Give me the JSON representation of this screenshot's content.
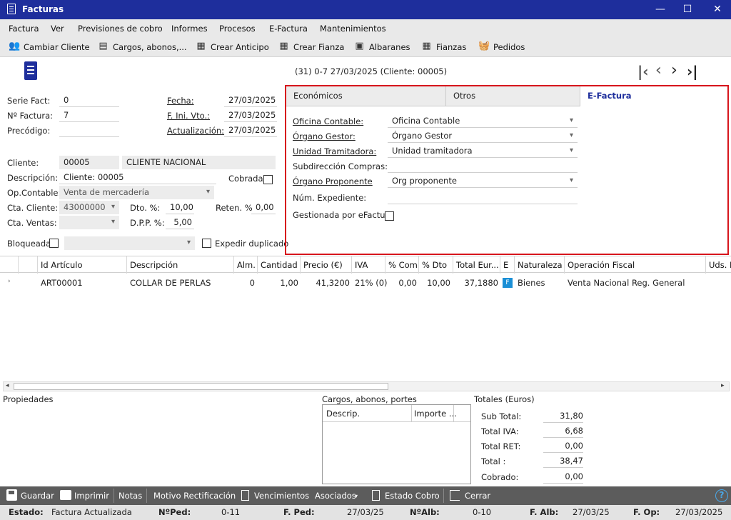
{
  "window": {
    "title": "Facturas",
    "minimize": "—",
    "maximize": "☐",
    "close": "✕"
  },
  "menu": [
    "Factura",
    "Ver",
    "Previsiones de cobro",
    "Informes",
    "Procesos",
    "E-Factura",
    "Mantenimientos"
  ],
  "toolbar": {
    "cambiar": "Cambiar Cliente",
    "cargos": "Cargos, abonos,...",
    "anticipo": "Crear Anticipo",
    "fianza": "Crear Fianza",
    "albaranes": "Albaranes",
    "fianzas": "Fianzas",
    "pedidos": "Pedidos"
  },
  "header_info": "(31) 0-7  27/03/2025  (Cliente: 00005)",
  "form": {
    "serie_label": "Serie Fact:",
    "serie": "0",
    "nfactura_label": "Nº Factura:",
    "nfactura": "7",
    "precodigo_label": "Precódigo:",
    "precodigo": "",
    "fecha_label": "Fecha:",
    "fecha": "27/03/2025",
    "fini_label": "F. Ini. Vto.:",
    "fini": "27/03/2025",
    "actual_label": "Actualización:",
    "actual": "27/03/2025",
    "cliente_label": "Cliente:",
    "cliente_code": "00005",
    "cliente_name": "CLIENTE NACIONAL",
    "desc_label": "Descripción:",
    "desc": "Cliente: 00005",
    "cobrada_label": "Cobrada:",
    "opcontable_label": "Op.Contable:",
    "opcontable": "Venta de mercadería",
    "ctacliente_label": "Cta. Cliente:",
    "ctacliente": "43000000",
    "dto_label": "Dto. %:",
    "dto": "10,00",
    "reten_label": "Reten. %",
    "reten": "0,00",
    "ctaventas_label": "Cta. Ventas:",
    "ctaventas": "",
    "dpp_label": "D.P.P. %:",
    "dpp": "5,00",
    "bloqueada_label": "Bloqueada",
    "expedir_label": "Expedir duplicado"
  },
  "efactura": {
    "tabs": [
      "Económicos",
      "Otros",
      "E-Factura"
    ],
    "oficina_label": "Oficina Contable:",
    "oficina": "Oficina Contable",
    "organo_label": "Órgano Gestor:",
    "organo": "Órgano Gestor",
    "unidad_label": "Unidad Tramitadora:",
    "unidad": "Unidad tramitadora",
    "subdir_label": "Subdirección Compras:",
    "subdir": "",
    "proponente_label": "Órgano Proponente",
    "proponente": "Org proponente",
    "expediente_label": "Núm. Expediente:",
    "expediente": "",
    "gestionada_label": "Gestionada por eFactura"
  },
  "grid": {
    "headers": [
      "Id Artículo",
      "Descripción",
      "Alm.",
      "Cantidad",
      "Precio (€)",
      "IVA",
      "% Com",
      "% Dto",
      "Total Eur...",
      "E",
      "Naturaleza",
      "Operación Fiscal",
      "Uds. I"
    ],
    "rows": [
      [
        "ART00001",
        "COLLAR DE PERLAS",
        "0",
        "1,00",
        "41,3200",
        "21% (0)",
        "0,00",
        "10,00",
        "37,1880",
        "F",
        "Bienes",
        "Venta Nacional Reg. General",
        ""
      ]
    ]
  },
  "lower": {
    "propiedades": "Propiedades",
    "cargos_title": "Cargos, abonos, portes",
    "cargos_cols": [
      "Descrip.",
      "Importe ..."
    ],
    "totales_title": "Totales (Euros)",
    "subtotal_label": "Sub Total:",
    "subtotal": "31,80",
    "iva_label": "Total IVA:",
    "iva": "6,68",
    "ret_label": "Total RET:",
    "ret": "0,00",
    "total_label": "Total :",
    "total": "38,47",
    "cobrado_label": "Cobrado:",
    "cobrado": "0,00"
  },
  "bottombar": {
    "guardar": "Guardar",
    "imprimir": "Imprimir",
    "notas": "Notas",
    "motivo": "Motivo Rectificación",
    "vencimientos": "Vencimientos",
    "asociados": "Asociados",
    "estado": "Estado Cobro",
    "cerrar": "Cerrar",
    "help": "?"
  },
  "status": {
    "estado_label": "Estado:",
    "estado": "Factura Actualizada",
    "nped_label": "NºPed:",
    "nped": "0-11",
    "fped_label": "F. Ped:",
    "fped": "27/03/25",
    "nalb_label": "NºAlb:",
    "nalb": "0-10",
    "falb_label": "F. Alb:",
    "falb": "27/03/25",
    "fop_label": "F. Op:",
    "fop": "27/03/2025"
  },
  "colors": {
    "titlebar": "#1e2e9c",
    "highlight": "#d7151c",
    "efbadge": "#1a8fd6",
    "bottombar": "#5c5c5c"
  }
}
